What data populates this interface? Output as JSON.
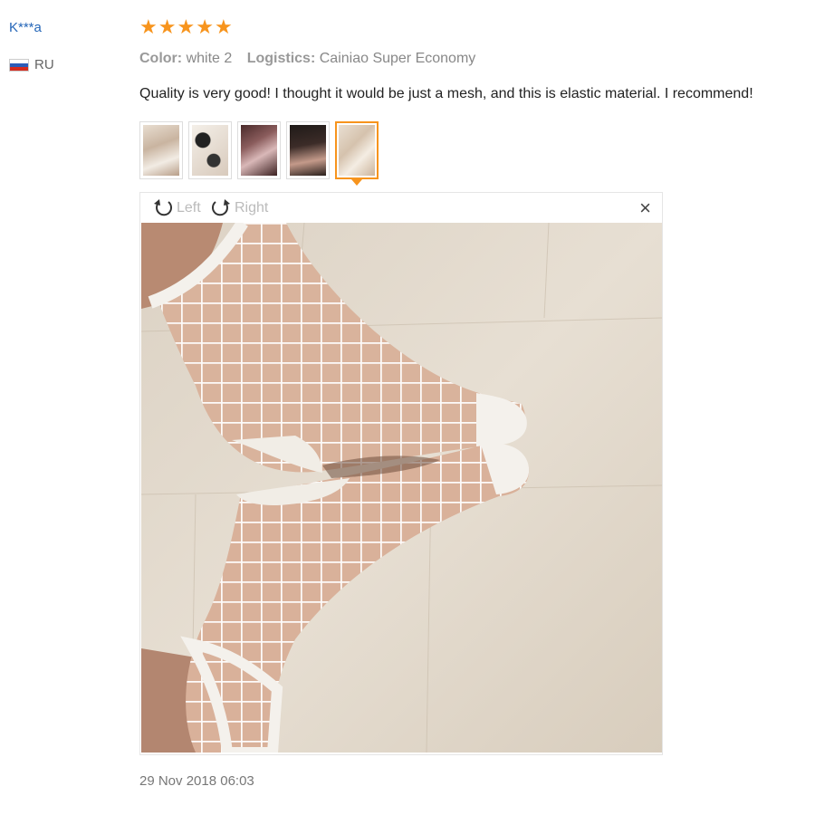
{
  "review": {
    "username": "K***a",
    "country": "RU",
    "rating": 5,
    "color_label": "Color:",
    "color_value": "white 2",
    "logistics_label": "Logistics:",
    "logistics_value": "Cainiao Super Economy",
    "text": "Quality is very good! I thought it would be just a mesh, and this is elastic material. I recommend!",
    "date": "29 Nov 2018 06:03"
  },
  "viewer": {
    "rotate_left_label": "Left",
    "rotate_right_label": "Right",
    "close_label": "×"
  },
  "thumbnails_count": 5,
  "active_thumbnail": 5,
  "colors": {
    "star": "#f7941d",
    "username": "#2566b8",
    "active_border": "#f7941d"
  }
}
